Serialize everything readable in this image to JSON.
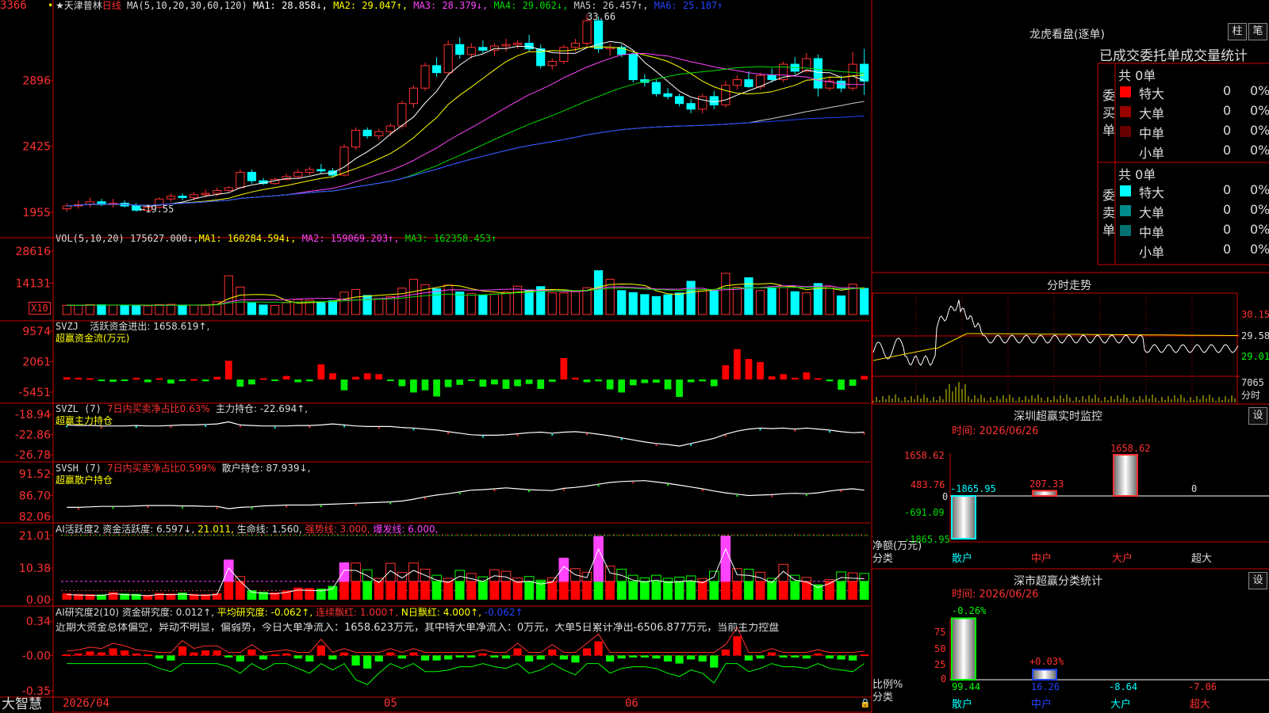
{
  "app": {
    "brand": "大智慧"
  },
  "header": {
    "stock_name": "天津普林",
    "period": "日线",
    "ma_prefix": "MA(5,10,20,30,60,120)",
    "ma_values": [
      {
        "label": "MA1: 28.858↓,",
        "color": "#ffffff"
      },
      {
        "label": "MA2: 29.047↑,",
        "color": "#ffff00"
      },
      {
        "label": "MA3: 28.379↓,",
        "color": "#ff44ff"
      },
      {
        "label": "MA4: 29.062↓,",
        "color": "#00dd00"
      },
      {
        "label": "MA5: 26.457↑,",
        "color": "#cccccc"
      },
      {
        "label": "MA6: 25.187↑",
        "color": "#2244ff"
      }
    ]
  },
  "price_panel": {
    "y_labels": [
      "3366",
      "2896",
      "2425",
      "1955"
    ],
    "annot_high": "33.66",
    "annot_low": "19.55"
  },
  "vol_panel": {
    "title": "VOL(5,10,20)",
    "value": "175627.000↓,",
    "ma": [
      {
        "label": "MA1: 160284.594↓,",
        "color": "#ffff00"
      },
      {
        "label": "MA2: 159069.203↑,",
        "color": "#ff44ff"
      },
      {
        "label": "MA3: 162358.453↑",
        "color": "#00dd00"
      }
    ],
    "y_labels": [
      "28616",
      "14131"
    ],
    "unit": "X10"
  },
  "svzj_panel": {
    "title": "SVZJ",
    "desc": "活跃资金进出: 1658.619↑,",
    "sub": "超赢资金流(万元)",
    "y_labels": [
      "9574",
      "2061",
      "-5451"
    ]
  },
  "svzl_panel": {
    "title": "SVZL (7)",
    "desc1": "7日内买卖净占比0.63%",
    "desc2": "主力持仓: -22.694↑,",
    "sub": "超赢主力持仓",
    "y_labels": [
      "-18.94",
      "-22.86",
      "-26.78"
    ]
  },
  "svsh_panel": {
    "title": "SVSH (7)",
    "desc1": "7日内买卖净占比0.599%",
    "desc2": "散户持仓: 87.939↓,",
    "sub": "超赢散户持仓",
    "y_labels": [
      "91.52",
      "86.70",
      "82.06"
    ]
  },
  "ai2_panel": {
    "title": "AI活跃度2",
    "items": [
      {
        "label": "资金活跃度: 6.597↓,",
        "color": "#dddddd"
      },
      {
        "label": "21.011,",
        "color": "#ffff00"
      },
      {
        "label": "生命线: 1.560,",
        "color": "#dddddd"
      },
      {
        "label": "强势线: 3.000,",
        "color": "#ff3030"
      },
      {
        "label": "爆发线: 6.000,",
        "color": "#ff44ff"
      }
    ],
    "y_labels": [
      "21.01",
      "10.38",
      "0.00"
    ]
  },
  "ai_research": {
    "title": "AI研究度2(10)",
    "items": [
      {
        "label": "资金研究度: 0.012↑,",
        "color": "#dddddd"
      },
      {
        "label": "平均研究度: -0.062↑,",
        "color": "#ffff00"
      },
      {
        "label": "连续飘红: 1.000↑,",
        "color": "#ff3030"
      },
      {
        "label": "N日飘红: 4.000↑,",
        "color": "#ffff00"
      },
      {
        "label": "-0.062↑",
        "color": "#2244ff"
      }
    ],
    "comment": "近期大资金总体偏空，异动不明显，偏弱势，今日大单净流入：1658.623万元，其中特大单净流入：0万元，大单5日累计净出-6506.877万元，当前主力控盘",
    "y_labels": [
      "0.34",
      "-0.00",
      "-0.35"
    ]
  },
  "x_axis": {
    "labels": [
      "2026/04",
      "05",
      "06"
    ]
  },
  "right_panel": {
    "title": "龙虎看盘(逐单)",
    "btn_bar": "柱",
    "btn_pen": "笔",
    "tabs": [
      "已成交",
      "委托单",
      "成交量统计"
    ],
    "buy": {
      "side_label": "委买单",
      "total": "共 0单",
      "rows": [
        {
          "name": "特大",
          "count": "0",
          "pct": "0%",
          "color": "#ff0000"
        },
        {
          "name": "大单",
          "count": "0",
          "pct": "0%",
          "color": "#990000"
        },
        {
          "name": "中单",
          "count": "0",
          "pct": "0%",
          "color": "#660000"
        },
        {
          "name": "小单",
          "count": "0",
          "pct": "0%",
          "color": "#000000"
        }
      ]
    },
    "sell": {
      "side_label": "委卖单",
      "total": "共 0单",
      "rows": [
        {
          "name": "特大",
          "count": "0",
          "pct": "0%",
          "color": "#00ffff"
        },
        {
          "name": "大单",
          "count": "0",
          "pct": "0%",
          "color": "#008b8b"
        },
        {
          "name": "中单",
          "count": "0",
          "pct": "0%",
          "color": "#007070"
        },
        {
          "name": "小单",
          "count": "0",
          "pct": "0%",
          "color": "#000000"
        }
      ]
    }
  },
  "intraday": {
    "title": "分时走势",
    "y_labels": [
      "30.15",
      "29.58",
      "29.01"
    ],
    "vol_label": "7065",
    "vol_sub": "分时"
  },
  "monitor": {
    "title": "深圳超赢实时监控",
    "btn": "设",
    "time": "时间: 2026/06/26",
    "y_labels": [
      "1658.62",
      "483.76",
      "0",
      "-691.09",
      "-1865.95"
    ],
    "left_label1": "净额(万元)",
    "left_label2": "分类",
    "categories": [
      "散户",
      "中户",
      "大户",
      "超大"
    ],
    "value_labels": [
      "-1865.95",
      "207.33",
      "1658.62",
      "0"
    ]
  },
  "class_stats": {
    "title": "深市超赢分类统计",
    "btn": "设",
    "time": "时间: 2026/06/26",
    "y_labels": [
      "75",
      "50",
      "25",
      "0"
    ],
    "left_label1": "比例%",
    "left_label2": "分类",
    "top_labels": [
      "-0.26%",
      "+0.03%"
    ],
    "categories": [
      "散户",
      "中户",
      "大户",
      "超大"
    ],
    "values": [
      "99.44",
      "16.26",
      "-8.64",
      "-7.06"
    ]
  },
  "chart_data": [
    {
      "type": "candlestick",
      "title": "天津普林 日线",
      "ylim": [
        19.55,
        33.66
      ],
      "annotations": {
        "high": 33.66,
        "low": 19.55
      },
      "ohlc": [
        [
          19.8,
          20.2,
          19.6,
          20.0
        ],
        [
          20.0,
          20.4,
          19.8,
          20.1
        ],
        [
          20.1,
          20.6,
          19.9,
          20.3
        ],
        [
          20.3,
          20.5,
          20.0,
          20.1
        ],
        [
          20.1,
          20.5,
          19.9,
          20.2
        ],
        [
          20.2,
          20.4,
          19.9,
          20.0
        ],
        [
          20.0,
          20.2,
          19.6,
          19.7
        ],
        [
          19.7,
          20.1,
          19.55,
          19.9
        ],
        [
          19.9,
          20.6,
          19.8,
          20.5
        ],
        [
          20.5,
          20.9,
          20.3,
          20.7
        ],
        [
          20.7,
          20.9,
          20.4,
          20.6
        ],
        [
          20.6,
          21.0,
          20.4,
          20.8
        ],
        [
          20.8,
          21.2,
          20.6,
          20.9
        ],
        [
          20.9,
          21.3,
          20.7,
          21.1
        ],
        [
          21.1,
          21.4,
          21.0,
          21.3
        ],
        [
          21.3,
          21.5,
          22.6,
          22.4
        ],
        [
          22.4,
          22.6,
          21.6,
          21.8
        ],
        [
          21.8,
          22.0,
          21.5,
          21.6
        ],
        [
          21.6,
          22.0,
          21.5,
          21.9
        ],
        [
          21.9,
          22.3,
          21.8,
          22.1
        ],
        [
          22.1,
          22.6,
          22.0,
          22.4
        ],
        [
          22.4,
          22.8,
          22.2,
          22.6
        ],
        [
          22.6,
          23.0,
          22.3,
          22.5
        ],
        [
          22.5,
          22.7,
          22.0,
          22.2
        ],
        [
          22.2,
          24.4,
          22.1,
          24.2
        ],
        [
          24.2,
          25.6,
          24.0,
          25.4
        ],
        [
          25.4,
          25.6,
          24.8,
          25.0
        ],
        [
          25.0,
          25.5,
          24.7,
          25.3
        ],
        [
          25.3,
          25.9,
          25.0,
          25.7
        ],
        [
          25.7,
          27.5,
          25.5,
          27.3
        ],
        [
          27.3,
          28.6,
          27.0,
          28.4
        ],
        [
          28.4,
          30.2,
          28.2,
          30.0
        ],
        [
          30.0,
          30.6,
          29.2,
          29.5
        ],
        [
          29.5,
          31.8,
          29.3,
          31.5
        ],
        [
          31.5,
          32.0,
          30.5,
          30.8
        ],
        [
          30.8,
          31.6,
          30.5,
          31.3
        ],
        [
          31.3,
          31.8,
          30.9,
          31.1
        ],
        [
          31.1,
          31.6,
          30.7,
          31.4
        ],
        [
          31.4,
          31.9,
          31.0,
          31.5
        ],
        [
          31.5,
          31.8,
          31.2,
          31.6
        ],
        [
          31.6,
          32.2,
          31.0,
          31.2
        ],
        [
          31.2,
          31.5,
          29.8,
          30.0
        ],
        [
          30.0,
          30.5,
          29.7,
          30.3
        ],
        [
          30.3,
          31.5,
          30.1,
          31.3
        ],
        [
          31.3,
          31.9,
          31.0,
          31.6
        ],
        [
          31.6,
          33.66,
          31.4,
          33.2
        ],
        [
          33.2,
          33.5,
          30.9,
          31.2
        ],
        [
          31.2,
          31.6,
          30.7,
          31.3
        ],
        [
          31.3,
          31.5,
          30.6,
          30.8
        ],
        [
          30.8,
          31.0,
          28.8,
          29.0
        ],
        [
          29.0,
          29.4,
          28.5,
          28.8
        ],
        [
          28.8,
          29.0,
          27.8,
          28.0
        ],
        [
          28.0,
          28.4,
          27.6,
          27.8
        ],
        [
          27.8,
          28.0,
          27.1,
          27.3
        ],
        [
          27.3,
          27.6,
          26.6,
          26.9
        ],
        [
          26.9,
          28.0,
          26.6,
          27.8
        ],
        [
          27.8,
          28.2,
          26.9,
          27.2
        ],
        [
          27.2,
          28.9,
          27.0,
          28.6
        ],
        [
          28.6,
          29.3,
          28.3,
          29.0
        ],
        [
          29.0,
          29.6,
          28.4,
          28.5
        ],
        [
          28.5,
          29.5,
          28.3,
          29.3
        ],
        [
          29.3,
          29.8,
          28.8,
          29.0
        ],
        [
          29.0,
          30.3,
          28.8,
          30.1
        ],
        [
          30.1,
          30.6,
          29.4,
          29.6
        ],
        [
          29.6,
          30.9,
          29.5,
          30.5
        ],
        [
          30.5,
          30.8,
          27.8,
          28.4
        ],
        [
          28.4,
          29.2,
          28.2,
          28.9
        ],
        [
          28.9,
          29.3,
          28.1,
          28.4
        ],
        [
          28.4,
          31.0,
          28.2,
          30.1
        ],
        [
          30.1,
          31.2,
          27.9,
          28.9
        ]
      ]
    },
    {
      "type": "bar",
      "title": "VOL(5,10,20)",
      "ylim": [
        0,
        28616
      ],
      "values": [
        4200,
        4100,
        4500,
        4400,
        4200,
        4300,
        4000,
        3900,
        4500,
        4600,
        4300,
        4200,
        4000,
        5800,
        17500,
        12400,
        5200,
        4300,
        4100,
        5300,
        6800,
        6400,
        5300,
        6200,
        10100,
        11300,
        8600,
        7100,
        8100,
        11900,
        15900,
        13500,
        11600,
        13300,
        10200,
        9500,
        8700,
        9300,
        10100,
        12800,
        11100,
        12600,
        9800,
        9700,
        10300,
        12100,
        19800,
        15900,
        10800,
        9900,
        9000,
        8100,
        8900,
        9700,
        15000,
        11200,
        10600,
        18600,
        12300,
        16600,
        10800,
        12100,
        12800,
        10300,
        9800,
        14000,
        12600,
        8400,
        13700,
        11800
      ]
    },
    {
      "type": "bar",
      "title": "SVZJ 超赢资金流(万元)",
      "ylim": [
        -5451,
        9574
      ],
      "values": [
        500,
        400,
        300,
        -300,
        -500,
        -200,
        400,
        -600,
        300,
        -900,
        -200,
        100,
        -400,
        600,
        4200,
        -1600,
        -1100,
        300,
        -200,
        800,
        -600,
        -400,
        3400,
        1400,
        -2400,
        600,
        1400,
        1200,
        -300,
        -1500,
        -2900,
        -2400,
        -3800,
        -1700,
        -1200,
        -300,
        -1600,
        -1100,
        -2100,
        -1500,
        -1000,
        -2100,
        -500,
        4800,
        400,
        -600,
        -400,
        -2200,
        -2900,
        -1300,
        -800,
        -700,
        -2200,
        -3900,
        -600,
        -400,
        -1500,
        3200,
        6800,
        4600,
        3900,
        700,
        1200,
        400,
        1600,
        300,
        -400,
        -2300,
        -1400,
        800
      ]
    },
    {
      "type": "line",
      "title": "SVZL 超赢主力持仓",
      "ylim": [
        -26.78,
        -18.94
      ],
      "values": [
        -21.0,
        -21.1,
        -21.1,
        -21.2,
        -21.2,
        -21.2,
        -21.1,
        -21.2,
        -21.2,
        -21.1,
        -21.0,
        -21.0,
        -20.9,
        -20.8,
        -20.4,
        -21.0,
        -21.1,
        -21.2,
        -21.2,
        -21.2,
        -21.1,
        -21.1,
        -21.0,
        -20.8,
        -21.0,
        -21.2,
        -21.3,
        -21.3,
        -21.3,
        -21.5,
        -21.6,
        -21.8,
        -22.0,
        -22.3,
        -22.6,
        -22.9,
        -23.0,
        -23.0,
        -22.9,
        -22.7,
        -22.5,
        -22.4,
        -22.6,
        -22.4,
        -22.3,
        -22.5,
        -22.8,
        -23.1,
        -23.5,
        -23.9,
        -24.3,
        -24.6,
        -24.8,
        -25.1,
        -24.6,
        -24.1,
        -23.6,
        -22.8,
        -22.2,
        -21.8,
        -21.6,
        -21.7,
        -21.6,
        -21.8,
        -21.6,
        -21.8,
        -22.0,
        -22.3,
        -22.5,
        -22.4
      ]
    },
    {
      "type": "line",
      "title": "SVSH 超赢散户持仓",
      "ylim": [
        82.06,
        91.52
      ],
      "values": [
        84.1,
        84.1,
        84.2,
        84.3,
        84.3,
        84.3,
        84.4,
        84.5,
        84.5,
        84.5,
        84.4,
        84.4,
        84.3,
        84.3,
        83.8,
        84.1,
        84.2,
        84.4,
        84.5,
        84.6,
        84.6,
        84.6,
        84.7,
        84.8,
        84.9,
        85.0,
        85.1,
        85.2,
        85.3,
        85.5,
        85.9,
        86.4,
        86.8,
        87.1,
        87.5,
        87.9,
        88.0,
        88.2,
        88.4,
        88.2,
        88.0,
        87.9,
        87.8,
        88.3,
        88.5,
        88.8,
        89.2,
        89.6,
        89.8,
        89.9,
        90.0,
        89.7,
        89.4,
        89.0,
        88.6,
        88.2,
        87.7,
        87.3,
        87.0,
        86.7,
        86.8,
        86.9,
        87.1,
        87.2,
        87.1,
        87.3,
        87.7,
        88.0,
        88.2,
        87.9
      ]
    },
    {
      "type": "bar",
      "title": "AI活跃度2",
      "ylim": [
        0,
        21.01
      ],
      "values": [
        2.1,
        1.9,
        1.8,
        1.7,
        2.5,
        2.0,
        1.9,
        1.6,
        2.2,
        2.0,
        2.3,
        1.9,
        1.8,
        2.1,
        13.0,
        7.6,
        3.1,
        2.6,
        2.4,
        3.0,
        4.0,
        3.8,
        3.6,
        4.5,
        12.1,
        12.0,
        9.8,
        7.0,
        11.9,
        8.9,
        12.0,
        10.0,
        8.0,
        7.0,
        9.6,
        8.6,
        7.5,
        9.8,
        9.3,
        7.1,
        7.6,
        6.4,
        7.2,
        13.6,
        10.2,
        9.0,
        20.7,
        11.0,
        10.0,
        8.0,
        7.2,
        8.0,
        7.0,
        7.4,
        7.8,
        6.9,
        9.3,
        20.8,
        10.2,
        10.0,
        9.0,
        7.0,
        11.6,
        8.0,
        7.3,
        5.0,
        6.6,
        9.1,
        8.8,
        8.6
      ],
      "lines": {
        "强势线": 3.0,
        "爆发线": 6.0,
        "21.011": 21.011
      }
    },
    {
      "type": "bar",
      "title": "AI研究度2(10)",
      "ylim": [
        -0.35,
        0.34
      ],
      "values": [
        0.01,
        0.02,
        0.04,
        0.03,
        0.07,
        0.05,
        0.02,
        0.01,
        -0.03,
        -0.05,
        0.09,
        0.03,
        0.05,
        0.05,
        -0.02,
        -0.06,
        0.06,
        -0.04,
        0.01,
        0.02,
        -0.03,
        -0.06,
        0.1,
        -0.04,
        0.03,
        -0.1,
        -0.13,
        -0.06,
        0.03,
        -0.03,
        0.03,
        -0.05,
        -0.05,
        -0.04,
        -0.02,
        -0.02,
        0.02,
        -0.02,
        -0.03,
        0.07,
        -0.06,
        -0.04,
        0.06,
        -0.04,
        -0.07,
        0.07,
        0.14,
        -0.06,
        -0.03,
        -0.02,
        -0.02,
        -0.03,
        -0.06,
        -0.08,
        -0.04,
        -0.06,
        -0.12,
        0.06,
        0.19,
        -0.05,
        -0.03,
        0.03,
        -0.02,
        -0.02,
        -0.03,
        0.02,
        -0.03,
        -0.04,
        -0.05,
        0.01
      ]
    }
  ]
}
